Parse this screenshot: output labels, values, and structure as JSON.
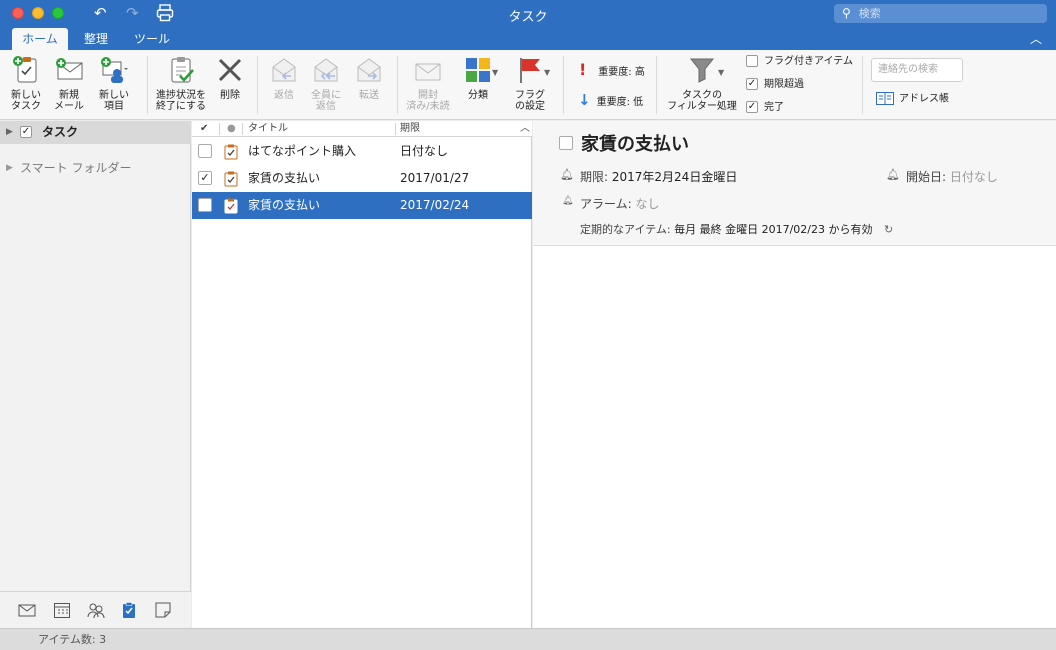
{
  "window": {
    "title": "タスク",
    "search_placeholder": "検索"
  },
  "tabs": [
    {
      "label": "ホーム",
      "active": true
    },
    {
      "label": "整理"
    },
    {
      "label": "ツール"
    }
  ],
  "ribbon": {
    "new_task": "新しい\nタスク",
    "new_mail": "新規\nメール",
    "new_item": "新しい\n項目",
    "mark_complete": "進捗状況を\n終了にする",
    "delete": "削除",
    "reply": "返信",
    "reply_all": "全員に\n返信",
    "forward": "転送",
    "read_unread": "開封\n済み/未読",
    "categorize": "分類",
    "flag": "フラグ\nの設定",
    "importance_high": "重要度: 高",
    "importance_low": "重要度: 低",
    "filter": "タスクの\nフィルター処理",
    "filter_flagged": "フラグ付きアイテム",
    "filter_overdue": "期限超過",
    "filter_complete": "完了",
    "contact_search_placeholder": "連絡先の検索",
    "address_book": "アドレス帳"
  },
  "folders": {
    "tasks": "タスク",
    "smart_folders": "スマート フォルダー"
  },
  "list": {
    "header_title": "タイトル",
    "header_due": "期限",
    "rows": [
      {
        "title": "はてなポイント購入",
        "due": "日付なし",
        "checked": false,
        "selected": false
      },
      {
        "title": "家賃の支払い",
        "due": "2017/01/27",
        "checked": true,
        "selected": false
      },
      {
        "title": "家賃の支払い",
        "due": "2017/02/24",
        "checked": false,
        "selected": true
      }
    ]
  },
  "detail": {
    "title": "家賃の支払い",
    "due_label": "期限:",
    "due_value": "2017年2月24日金曜日",
    "start_label": "開始日:",
    "start_value": "日付なし",
    "alarm_label": "アラーム:",
    "alarm_value": "なし",
    "recurrence_label": "定期的なアイテム:",
    "recurrence_value": "毎月 最終 金曜日 2017/02/23 から有効"
  },
  "status": {
    "item_count": "アイテム数: 3"
  },
  "colors": {
    "accent": "#2f6fc1",
    "flag_red": "#d9342b",
    "importance_high": "#e0252a",
    "importance_low": "#2f7de1"
  }
}
